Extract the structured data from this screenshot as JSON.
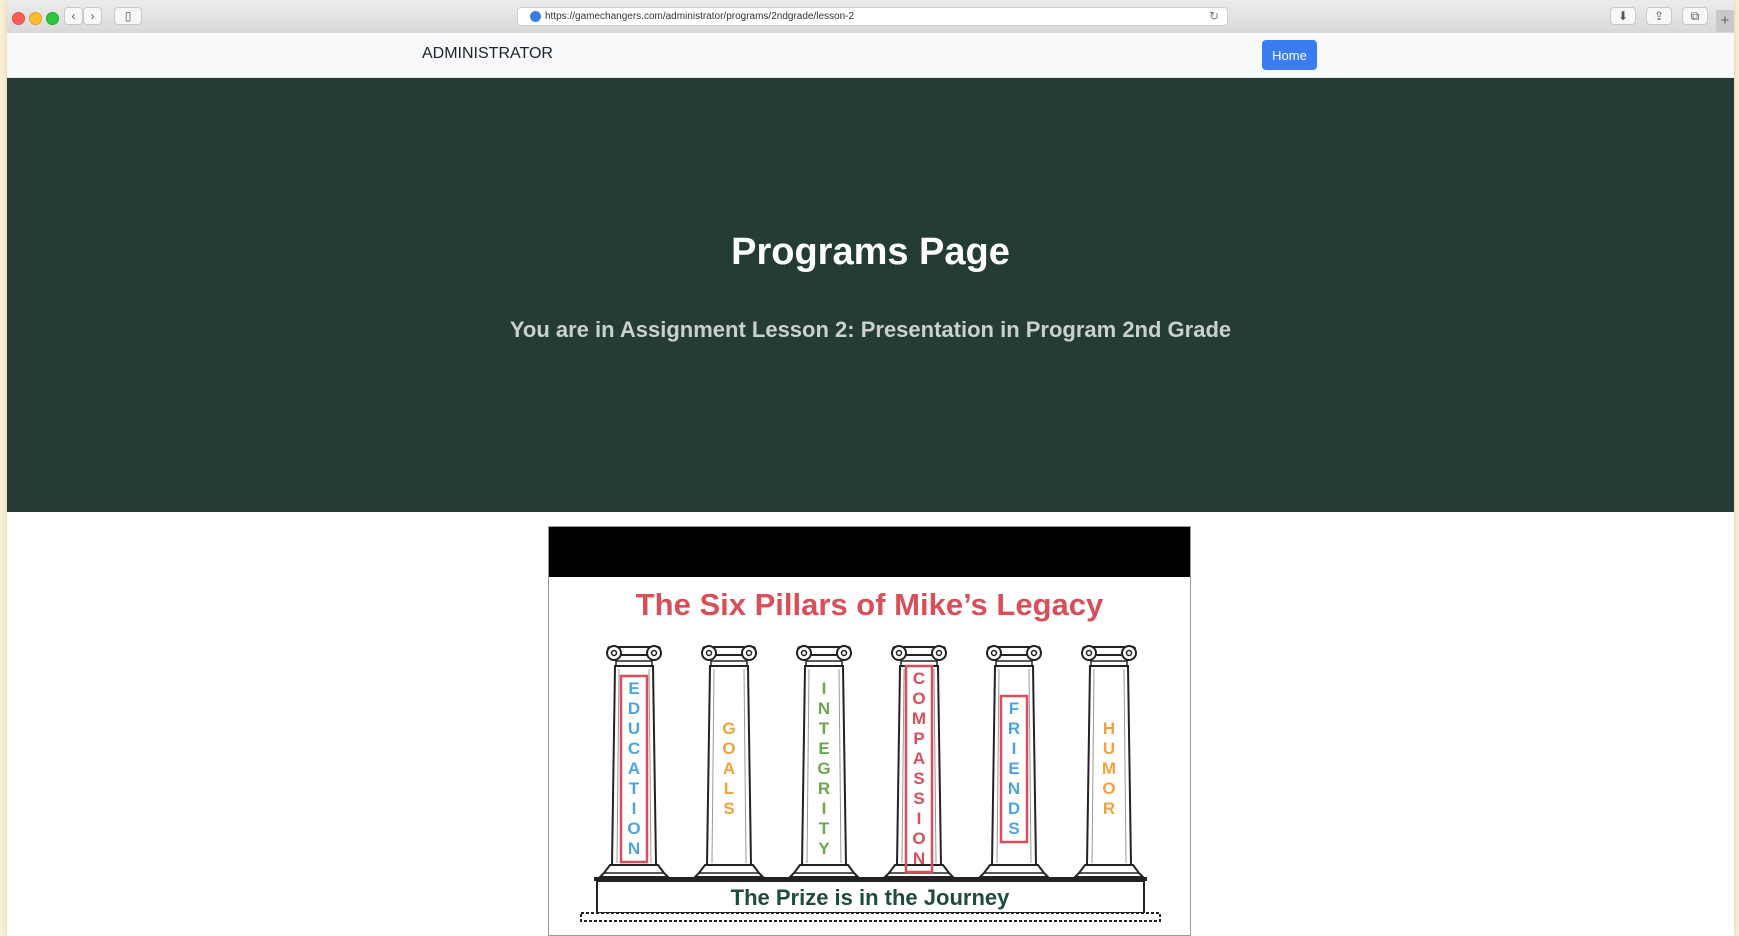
{
  "browser": {
    "url": "https://gamechangers.com/administrator/programs/2ndgrade/lesson-2"
  },
  "navbar": {
    "brand": "ADMINISTRATOR",
    "home_label": "Home"
  },
  "hero": {
    "title": "Programs Page",
    "subtitle": "You are in Assignment Lesson 2: Presentation in Program 2nd Grade"
  },
  "presentation": {
    "title": "The Six Pillars of Mike’s Legacy",
    "footer": "The Prize is in the Journey",
    "pillars": [
      {
        "word": "EDUCATION",
        "color": "#4da3e0",
        "boxed": true
      },
      {
        "word": "GOALS",
        "color": "#f0a33a",
        "boxed": false
      },
      {
        "word": "INTEGRITY",
        "color": "#6aa84f",
        "boxed": false
      },
      {
        "word": "COMPASSION",
        "color": "#d84f5a",
        "boxed": true
      },
      {
        "word": "FRIENDS",
        "color": "#4da3e0",
        "boxed": true
      },
      {
        "word": "HUMOR",
        "color": "#f0a33a",
        "boxed": false
      }
    ]
  }
}
